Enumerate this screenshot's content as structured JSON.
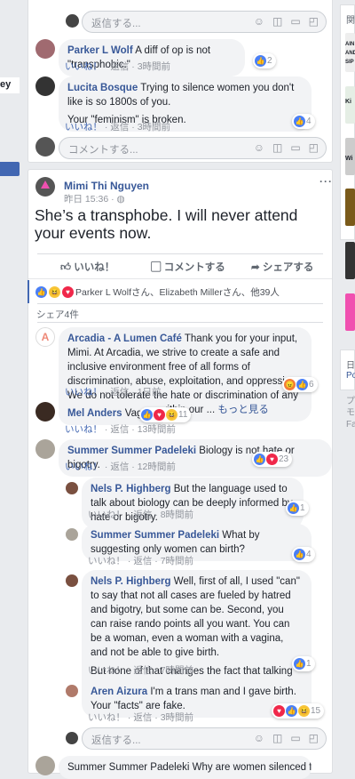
{
  "left_nav": {
    "item": "ey"
  },
  "right_rail": {
    "header": "関",
    "ad_text": [
      "AIN",
      "AND",
      "SIP"
    ],
    "ad2": "Ki",
    "ad3": "Wi",
    "footer1": "日",
    "footer2": "Po",
    "footer3": [
      "プ",
      "モ",
      "Fa"
    ]
  },
  "top_thread": {
    "reply_placeholder": "返信する...",
    "comments": [
      {
        "author": "Parker L Wolf",
        "text": "A diff of op is not \"transphobic.\"",
        "like": "いいね！",
        "reply": "返信",
        "time": "3時間前",
        "count": "2"
      },
      {
        "author": "Lucita Bosque",
        "text": "Trying to silence women you don't like is so 1800s of you.",
        "text2": "Your \"feminism\" is broken.",
        "like": "いいね！",
        "reply": "返信",
        "time": "3時間前",
        "count": "4"
      }
    ],
    "comment_placeholder": "コメントする..."
  },
  "post": {
    "author": "Mimi Thi Nguyen",
    "time": "昨日 15:36",
    "globe": "globe-icon",
    "text": "She’s a transphobe. I will never attend your events now.",
    "actions": {
      "like": "いいね！",
      "comment": "コメントする",
      "share": "シェアする"
    },
    "reactions": "Parker L Wolfさん、Elizabeth Millerさん、他39人",
    "shares": "シェア4件",
    "comments": [
      {
        "author": "Arcadia - A Lumen Café",
        "text": "Thank you for your input, Mimi. At Arcadia, we strive to create a safe and inclusive environment free of all forms of discrimination, abuse, exploitation, and oppression. We do not tolerate the hate or discrimination of any community member within our ...",
        "more": "もっと見る",
        "time": "1日前",
        "count": "6"
      },
      {
        "author": "Mel Anders",
        "text": "Vagina.",
        "time": "13時間前",
        "count": "11"
      },
      {
        "author": "Summer Summer Padeleki",
        "text": "Biology is not hate or bigotry.",
        "time": "12時間前",
        "count": "23"
      }
    ],
    "replies": [
      {
        "author": "Nels P. Highberg",
        "text": "But the language used to talk about biology can be deeply informed by hate or bigotry.",
        "time": "8時間前",
        "count": "1"
      },
      {
        "author": "Summer Summer Padeleki",
        "text": "What by suggesting only women can birth?",
        "time": "7時間前",
        "count": "4"
      },
      {
        "author": "Nels P. Highberg",
        "text": "Well, first of all, I used \"can\" to say that not all cases are fueled by hatred and bigotry, but some can be. Second, you can raise rando points all you want. You can be a woman, even a woman with a vagina, and not be able to give birth.",
        "text2": "But none of that changes the fact that talking about biology can mean using language informed by hate and bigotry.",
        "time": "7時間前",
        "count": "1"
      },
      {
        "author": "Aren Aizura",
        "text": "I'm a trans man and I gave birth. Your \"facts\" are fake.",
        "time": "3時間前",
        "count": "15"
      }
    ],
    "like": "いいね！",
    "reply": "返信",
    "reply_placeholder": "返信する...",
    "partial": "Summer Summer Padeleki Why are women silenced for"
  },
  "colors": {
    "link": "#385898",
    "accent": "#4267b2",
    "bg": "#e9ebee"
  }
}
